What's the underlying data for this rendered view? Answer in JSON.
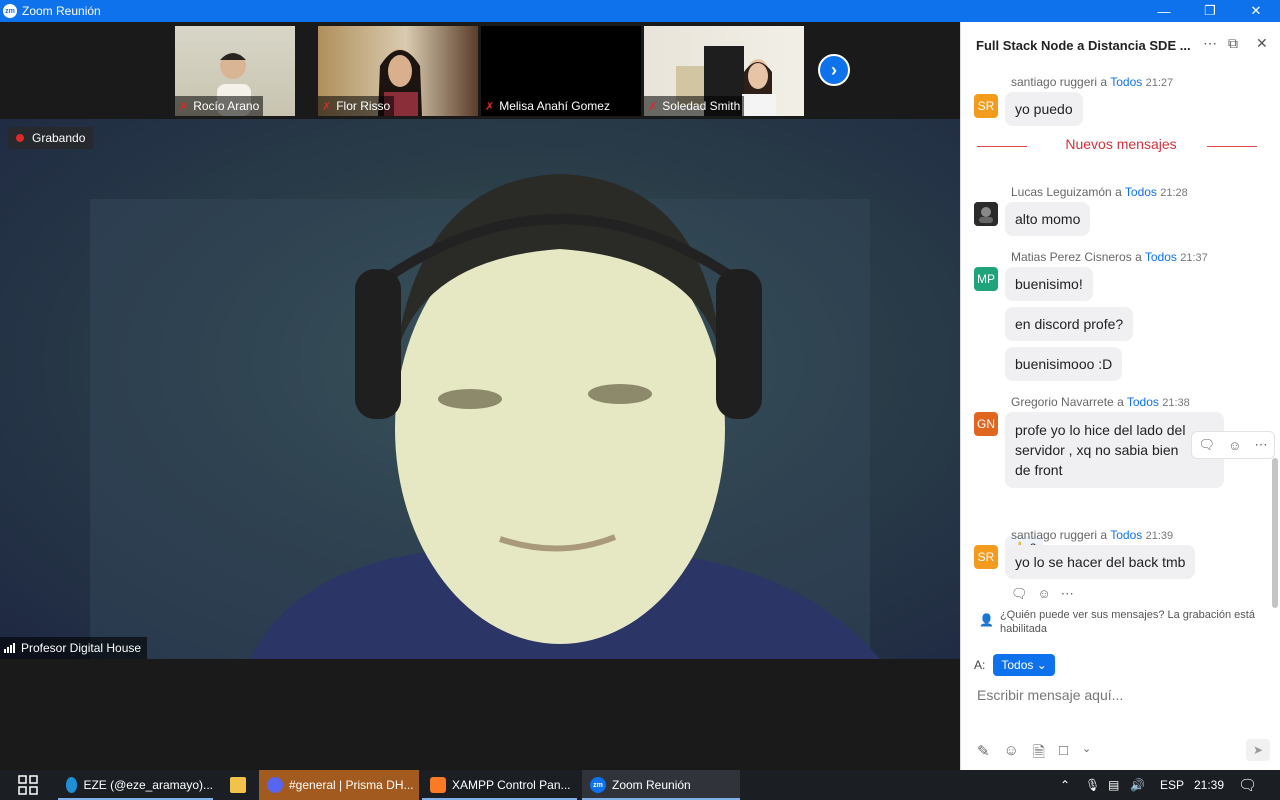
{
  "window": {
    "title": "Zoom Reunión"
  },
  "participants": [
    {
      "name": "Rocío Arano"
    },
    {
      "name": "Flor Risso"
    },
    {
      "name": "Melisa Anahí Gomez"
    },
    {
      "name": "Soledad Smith"
    }
  ],
  "recording": {
    "label": "Grabando"
  },
  "speaker": {
    "name": "Profesor Digital House"
  },
  "chat": {
    "title": "Full Stack Node a Distancia SDE ...",
    "new_messages_label": "Nuevos mensajes",
    "messages": [
      {
        "initials": "SR",
        "avatar_color": "#f29b1c",
        "sender": "santiago ruggeri",
        "to_word": "a",
        "recipient": "Todos",
        "time": "21:27",
        "texts": [
          "yo puedo"
        ]
      },
      {
        "initials": "",
        "avatar_color": "#333333",
        "sender": "Lucas Leguizamón",
        "to_word": "a",
        "recipient": "Todos",
        "time": "21:28",
        "texts": [
          "alto momo"
        ]
      },
      {
        "initials": "MP",
        "avatar_color": "#1fa37a",
        "sender": "Matias Perez Cisneros",
        "to_word": "a",
        "recipient": "Todos",
        "time": "21:37",
        "texts": [
          "buenisimo!",
          "en discord profe?",
          "buenisimooo :D"
        ]
      },
      {
        "initials": "GN",
        "avatar_color": "#e0651f",
        "sender": "Gregorio Navarrete",
        "to_word": "a",
        "recipient": "Todos",
        "time": "21:38",
        "texts": [
          "profe yo lo hice del lado del",
          "servidor , xq no sabia bien",
          "de front"
        ]
      },
      {
        "initials": "SR",
        "avatar_color": "#f29b1c",
        "sender": "santiago ruggeri",
        "to_word": "a",
        "recipient": "Todos",
        "time": "21:39",
        "texts": [
          "yo lo se hacer del back tmb"
        ]
      }
    ],
    "reaction": {
      "emoji": "👍",
      "count": "2"
    },
    "notice": "¿Quién puede ver sus mensajes? La grabación está habilitada",
    "to_label": "A:",
    "to_value": "Todos",
    "input_placeholder": "Escribir mensaje aquí..."
  },
  "taskbar": {
    "items": [
      {
        "label": "EZE (@eze_aramayo)...",
        "icon_color": "#1f8fd6"
      },
      {
        "label": "#general | Prisma DH...",
        "icon_color": "#5865f2"
      },
      {
        "label": "XAMPP Control Pan...",
        "icon_color": "#fb7a24"
      },
      {
        "label": "Zoom Reunión",
        "icon_color": "#0e72ed"
      }
    ],
    "lang": "ESP",
    "clock": "21:39"
  }
}
